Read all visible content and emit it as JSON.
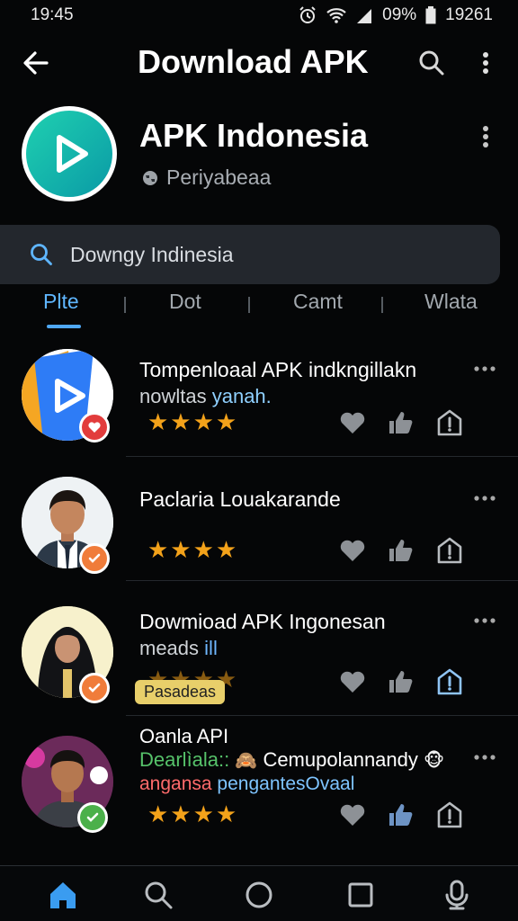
{
  "status_bar": {
    "time": "19:45",
    "battery": "09%",
    "right_text": "19261"
  },
  "app_bar": {
    "title": "Download APK"
  },
  "publisher": {
    "name": "APK Indonesia",
    "subtitle": "Periyabeaa"
  },
  "search": {
    "query": "Downgy Indinesia"
  },
  "tabs": [
    {
      "label": "Plte",
      "active": true
    },
    {
      "label": "Dot",
      "active": false
    },
    {
      "label": "Camt",
      "active": false
    },
    {
      "label": "Wlata",
      "active": false
    }
  ],
  "rows": [
    {
      "title": "Tompenloaal APK indkngillakn",
      "subtitle": "nowltas",
      "subtitle_extra": "yanah.",
      "stars": "★★★★",
      "rating": 4
    },
    {
      "title": "Paclaria Louakarande",
      "stars": "★★★★",
      "rating": 4
    },
    {
      "title": "Dowmioad APK Ingonesan",
      "subtitle": "meads",
      "subtitle_extra": "ill",
      "stars": "★★★★",
      "rating": 4,
      "tag": "Pasadeas"
    },
    {
      "title": "Oanla API",
      "subtitle": "Dearlìala::",
      "subtitle_extra": "Cemupolannandy",
      "subtitle3_a": "angansa",
      "subtitle3_b": "pengantesOvaal",
      "stars": "★★★★",
      "rating": 4
    }
  ],
  "colors": {
    "accent": "#4fa8f6",
    "star": "#f3a21a",
    "background": "#050607",
    "search_bg": "#23272d"
  },
  "bottom_nav": [
    {
      "icon": "home-icon",
      "active": true
    },
    {
      "icon": "search-icon",
      "active": false
    },
    {
      "icon": "circle-icon",
      "active": false
    },
    {
      "icon": "square-icon",
      "active": false
    },
    {
      "icon": "microphone-icon",
      "active": false
    }
  ]
}
